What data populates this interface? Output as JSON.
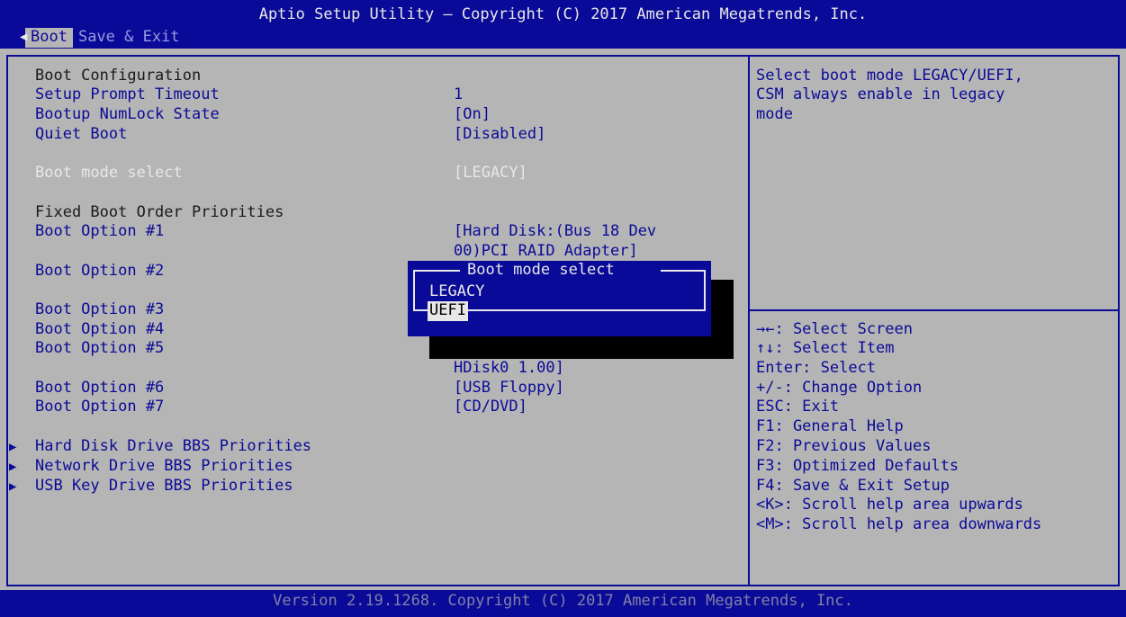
{
  "header": {
    "title": "Aptio Setup Utility – Copyright (C) 2017 American Megatrends, Inc.",
    "tabs": [
      {
        "label": "Boot",
        "active": true
      },
      {
        "label": "Save & Exit",
        "active": false
      }
    ]
  },
  "settings": {
    "boot_configuration": "Boot Configuration",
    "setup_prompt_timeout": {
      "label": "Setup Prompt Timeout",
      "value": "1"
    },
    "bootup_numlock": {
      "label": "Bootup NumLock State",
      "value": "[On]"
    },
    "quiet_boot": {
      "label": "Quiet Boot",
      "value": "[Disabled]"
    },
    "boot_mode_select": {
      "label": "Boot mode select",
      "value": "[LEGACY]"
    },
    "fixed_boot_order": "Fixed Boot Order Priorities",
    "boot_option_1": {
      "label": "Boot Option #1",
      "value_line1": "[Hard Disk:(Bus 18 Dev",
      "value_line2": "00)PCI RAID Adapter]"
    },
    "boot_option_2": {
      "label": "Boot Option #2"
    },
    "boot_option_3": {
      "label": "Boot Option #3"
    },
    "boot_option_4": {
      "label": "Boot Option #4"
    },
    "boot_option_5": {
      "label": "Boot Option #5",
      "value_line2": "HDisk0 1.00]"
    },
    "boot_option_6": {
      "label": "Boot Option #6",
      "value": "[USB Floppy]"
    },
    "boot_option_7": {
      "label": "Boot Option #7",
      "value": "[CD/DVD]"
    },
    "submenus": [
      "Hard Disk Drive BBS Priorities",
      "Network Drive BBS Priorities",
      "USB Key Drive BBS Priorities"
    ]
  },
  "help": {
    "description": [
      "Select boot mode LEGACY/UEFI,",
      "CSM always enable in legacy",
      "mode"
    ],
    "keys": [
      "→←: Select Screen",
      "↑↓: Select Item",
      "Enter: Select",
      "+/-: Change Option",
      "ESC: Exit",
      "F1: General Help",
      "F2: Previous Values",
      "F3: Optimized Defaults",
      "F4: Save & Exit Setup",
      "<K>: Scroll help area upwards",
      "<M>: Scroll help area downwards"
    ]
  },
  "popup": {
    "title": "Boot mode select",
    "options": [
      "LEGACY",
      "UEFI"
    ],
    "selected": "UEFI"
  },
  "footer": {
    "text": "Version 2.19.1268. Copyright (C) 2017 American Megatrends, Inc."
  },
  "colors": {
    "bios_blue": "#0a0a98",
    "bios_gray": "#b5b5b5",
    "text_white": "#e8e8e8"
  }
}
